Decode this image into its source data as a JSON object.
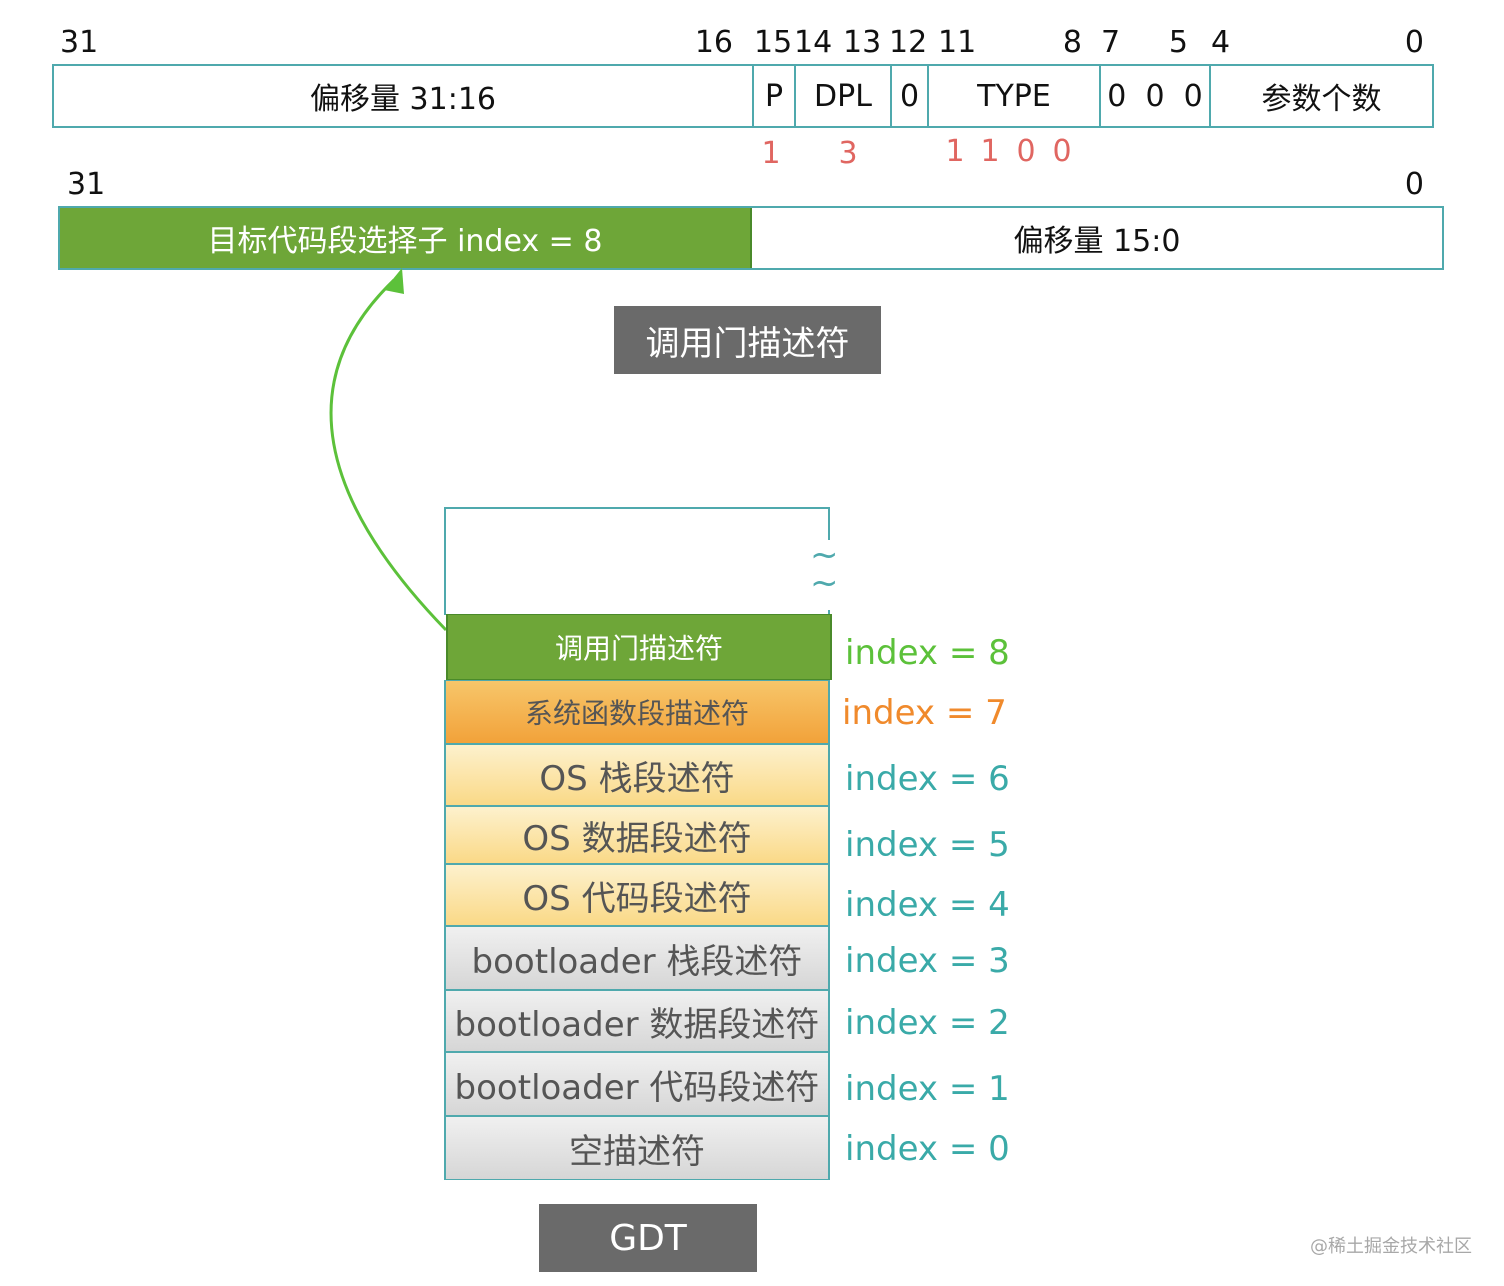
{
  "call_gate": {
    "high_word": {
      "bit_labels": [
        "31",
        "16",
        "15",
        "14",
        "13",
        "12",
        "11",
        "8",
        "7",
        "5",
        "4",
        "0"
      ],
      "fields": {
        "offset_high": "偏移量 31:16",
        "p": "P",
        "dpl": "DPL",
        "zero": "0",
        "type": "TYPE",
        "zeros": "0  0  0",
        "param_count": "参数个数"
      },
      "values": [
        "1",
        "3",
        "1",
        "1",
        "0",
        "0"
      ]
    },
    "low_word": {
      "bit_labels": [
        "31",
        "0"
      ],
      "selector": "目标代码段选择子 index = 8",
      "offset_low": "偏移量 15:0"
    },
    "caption": "调用门描述符"
  },
  "gdt": {
    "caption": "GDT",
    "break_symbol": "~",
    "entries": [
      {
        "label": "调用门描述符",
        "index": "index = 8",
        "bg": "#6ea638",
        "text_color": "#ffffff",
        "index_color": "#5cc13a"
      },
      {
        "label": "系统函数段描述符",
        "index": "index = 7",
        "bg": "#f2a23a",
        "text_color": "#555555",
        "index_color": "#f08a2c"
      },
      {
        "label": "OS 栈段述符",
        "index": "index = 6",
        "bg": "#fad987",
        "text_color": "#555555",
        "index_color": "#3aaaa8"
      },
      {
        "label": "OS 数据段述符",
        "index": "index = 5",
        "bg": "#fad987",
        "text_color": "#555555",
        "index_color": "#3aaaa8"
      },
      {
        "label": "OS 代码段述符",
        "index": "index = 4",
        "bg": "#fad987",
        "text_color": "#555555",
        "index_color": "#3aaaa8"
      },
      {
        "label": "bootloader 栈段述符",
        "index": "index = 3",
        "bg": "#d6d6d6",
        "text_color": "#555555",
        "index_color": "#3aaaa8"
      },
      {
        "label": "bootloader 数据段述符",
        "index": "index = 2",
        "bg": "#d6d6d6",
        "text_color": "#555555",
        "index_color": "#3aaaa8"
      },
      {
        "label": "bootloader 代码段述符",
        "index": "index = 1",
        "bg": "#d6d6d6",
        "text_color": "#555555",
        "index_color": "#3aaaa8"
      },
      {
        "label": "空描述符",
        "index": "index = 0",
        "bg": "#d6d6d6",
        "text_color": "#555555",
        "index_color": "#3aaaa8"
      }
    ]
  },
  "colors": {
    "border": "#4fa9ad",
    "selector_green": "#6ea638",
    "arrow_green": "#5cc13a",
    "value_red": "#e06661",
    "caption_bg": "#6a6a6a"
  },
  "watermark": "@稀土掘金技术社区"
}
